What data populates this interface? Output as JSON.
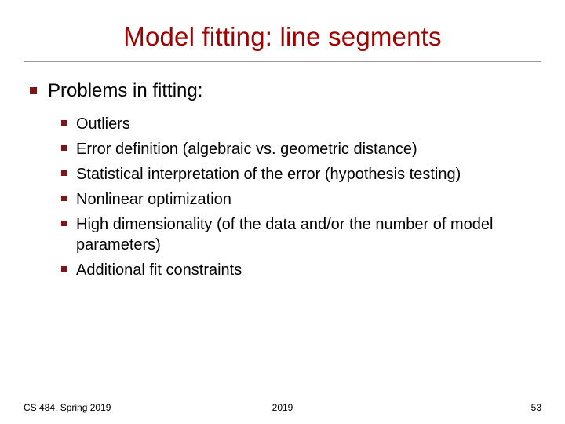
{
  "title": "Model fitting: line segments",
  "heading": "Problems in fitting:",
  "items": [
    "Outliers",
    "Error definition (algebraic vs. geometric distance)",
    "Statistical interpretation of the error (hypothesis testing)",
    "Nonlinear optimization",
    "High dimensionality (of the data and/or the number of model parameters)",
    "Additional fit constraints"
  ],
  "footer": {
    "left": "CS 484, Spring 2019",
    "center": "2019",
    "right": "53"
  },
  "colors": {
    "title": "#a00000",
    "bullet": "#7a1818"
  }
}
